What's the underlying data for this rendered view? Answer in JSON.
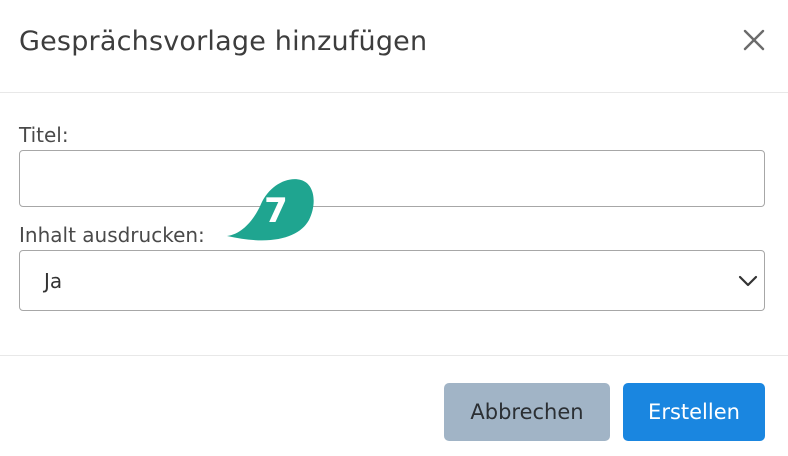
{
  "dialog": {
    "title": "Gesprächsvorlage hinzufügen",
    "close_icon": "close-icon"
  },
  "form": {
    "title_label": "Titel:",
    "title_value": "",
    "print_label": "Inhalt ausdrucken:",
    "print_value": "Ja",
    "print_chevron_icon": "chevron-down-icon"
  },
  "callout": {
    "number": "7",
    "color": "#1fa590"
  },
  "footer": {
    "cancel_label": "Abbrechen",
    "create_label": "Erstellen"
  },
  "colors": {
    "primary": "#1a86e0",
    "secondary": "#a1b4c6",
    "callout": "#1fa590"
  }
}
